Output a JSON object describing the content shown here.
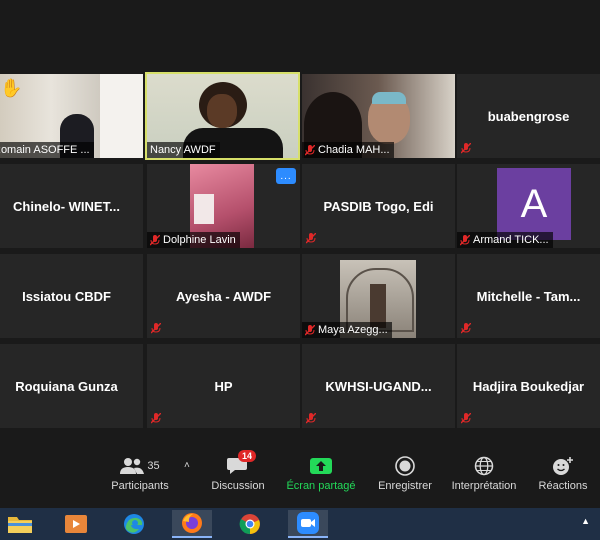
{
  "tiles": [
    {
      "name": "Romain ASOFFE ...",
      "type": "video",
      "label": true
    },
    {
      "name": "Nancy AWDF",
      "type": "video",
      "label": true,
      "active": true
    },
    {
      "name": "Chadia MAH...",
      "type": "video",
      "label": true
    },
    {
      "name": "buabengrose",
      "type": "name"
    },
    {
      "name": "Chinelo-  WINET...",
      "type": "name"
    },
    {
      "name": "Dolphine Lavin",
      "type": "video",
      "label": true
    },
    {
      "name": "PASDIB Togo,  Edi",
      "type": "name"
    },
    {
      "name": "Armand TICK...",
      "type": "avatar",
      "label": true
    },
    {
      "name": "Issiatou  CBDF",
      "type": "name"
    },
    {
      "name": "Ayesha - AWDF",
      "type": "name"
    },
    {
      "name": "Maya Azegg...",
      "type": "video",
      "label": true
    },
    {
      "name": "Mitchelle  -  Tam...",
      "type": "name"
    },
    {
      "name": "Roquiana Gunza",
      "type": "name"
    },
    {
      "name": "HP",
      "type": "name"
    },
    {
      "name": "KWHSI-UGAND...",
      "type": "name"
    },
    {
      "name": "Hadjira Boukedjar",
      "type": "name"
    }
  ],
  "avatar_letter": "A",
  "more_label": "...",
  "toolbar": {
    "participants_label": "Participants",
    "participants_count": "35",
    "chat_label": "Discussion",
    "chat_badge": "14",
    "share_label": "Écran partagé",
    "record_label": "Enregistrer",
    "interpretation_label": "Interprétation",
    "reactions_label": "Réactions"
  },
  "colors": {
    "share_green": "#23d959",
    "mute_red": "#e02828",
    "active_border": "#d7e06a",
    "badge_red": "#e02828"
  }
}
